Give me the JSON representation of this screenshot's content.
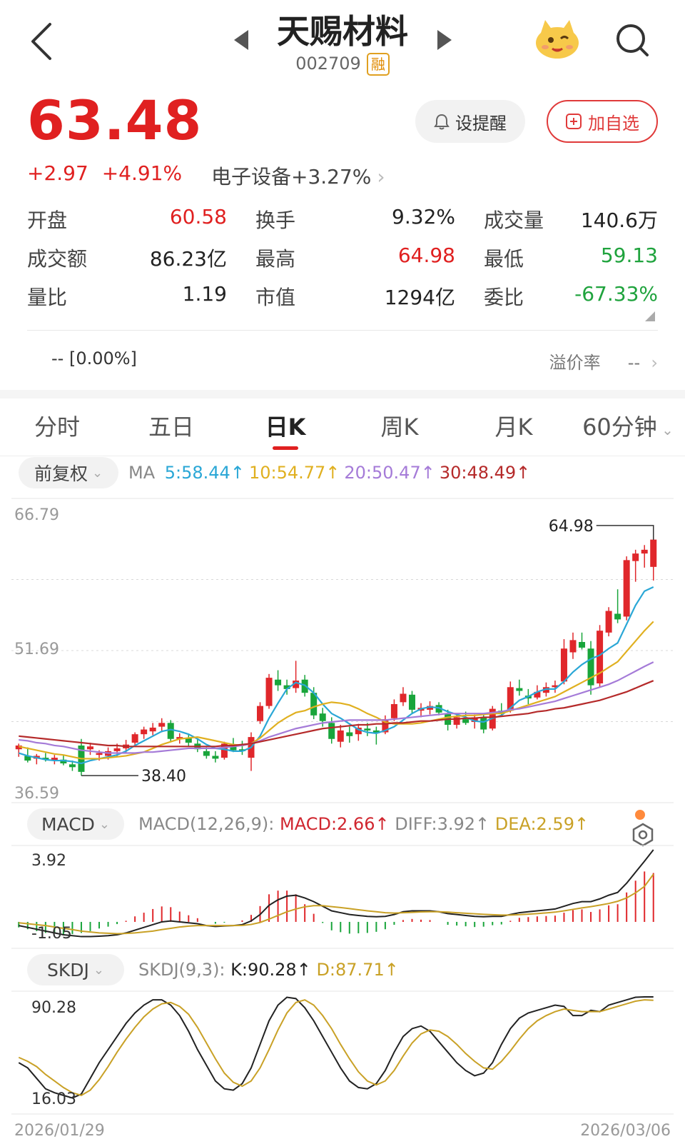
{
  "header": {
    "name": "天赐材料",
    "code": "002709",
    "badge": "融"
  },
  "quote": {
    "price": "63.48",
    "change": "+2.97",
    "change_pct": "+4.91%",
    "sector": "电子设备+3.27%",
    "alert_label": "设提醒",
    "add_label": "加自选"
  },
  "stats": [
    [
      {
        "label": "开盘",
        "value": "60.58",
        "color": "red"
      },
      {
        "label": "换手",
        "value": "9.32%",
        "color": "black"
      },
      {
        "label": "成交量",
        "value": "140.6万",
        "color": "black"
      }
    ],
    [
      {
        "label": "成交额",
        "value": "86.23亿",
        "color": "black"
      },
      {
        "label": "最高",
        "value": "64.98",
        "color": "red"
      },
      {
        "label": "最低",
        "value": "59.13",
        "color": "green"
      }
    ],
    [
      {
        "label": "量比",
        "value": "1.19",
        "color": "black"
      },
      {
        "label": "市值",
        "value": "1294亿",
        "color": "black"
      },
      {
        "label": "委比",
        "value": "-67.33%",
        "color": "green"
      }
    ]
  ],
  "premium": {
    "left": "-- [0.00%]",
    "label": "溢价率",
    "value": "--"
  },
  "tabs": [
    "分时",
    "五日",
    "日K",
    "周K",
    "月K",
    "60分钟"
  ],
  "active_tab": 2,
  "ma_panel": {
    "adjust_label": "前复权",
    "prefix": "MA",
    "items": [
      {
        "text": "5:58.44↑",
        "color": "#2aa7d6"
      },
      {
        "text": "10:54.77↑",
        "color": "#e0b020"
      },
      {
        "text": "20:50.47↑",
        "color": "#a57bd8"
      },
      {
        "text": "30:48.49↑",
        "color": "#b52a2a"
      }
    ]
  },
  "macd_panel": {
    "label": "MACD",
    "params": "MACD(12,26,9):",
    "macd": "MACD:2.66↑",
    "diff": "DIFF:3.92↑",
    "dea": "DEA:2.59↑"
  },
  "skdj_panel": {
    "label": "SKDJ",
    "params": "SKDJ(9,3):",
    "k": "K:90.28↑",
    "d": "D:87.71↑"
  },
  "chart_data": {
    "type": "candlestick",
    "price_axis": {
      "top": "66.79",
      "mid": "51.69",
      "bottom": "36.59",
      "max": 66.79,
      "min": 36.59
    },
    "annotations": {
      "high": "64.98",
      "low": "38.40"
    },
    "candles": [
      [
        41.2,
        41.8,
        40.4,
        41.6
      ],
      [
        40.5,
        41.4,
        39.8,
        40.0
      ],
      [
        40.2,
        40.7,
        39.6,
        40.5
      ],
      [
        40.3,
        40.8,
        39.9,
        40.1
      ],
      [
        40.0,
        40.6,
        39.6,
        40.3
      ],
      [
        40.1,
        40.6,
        39.5,
        39.7
      ],
      [
        39.6,
        40.0,
        38.9,
        39.3
      ],
      [
        41.6,
        42.3,
        38.4,
        38.8
      ],
      [
        41.2,
        41.9,
        40.6,
        41.5
      ],
      [
        40.6,
        41.1,
        40.0,
        40.8
      ],
      [
        40.5,
        41.4,
        40.1,
        41.0
      ],
      [
        41.0,
        41.8,
        40.4,
        41.3
      ],
      [
        41.3,
        42.2,
        40.8,
        41.7
      ],
      [
        41.9,
        43.0,
        41.5,
        42.8
      ],
      [
        42.8,
        43.6,
        42.3,
        43.3
      ],
      [
        43.1,
        44.0,
        42.7,
        43.5
      ],
      [
        43.6,
        44.5,
        43.0,
        44.0
      ],
      [
        44.0,
        44.3,
        42.0,
        42.3
      ],
      [
        42.3,
        42.9,
        41.8,
        42.5
      ],
      [
        42.4,
        42.8,
        41.5,
        41.9
      ],
      [
        41.8,
        42.3,
        40.9,
        41.2
      ],
      [
        41.0,
        41.4,
        40.2,
        40.5
      ],
      [
        40.5,
        41.0,
        39.8,
        40.2
      ],
      [
        40.3,
        42.0,
        40.1,
        41.8
      ],
      [
        41.6,
        42.4,
        40.9,
        41.1
      ],
      [
        41.2,
        42.1,
        40.6,
        41.0
      ],
      [
        40.3,
        43.0,
        38.9,
        42.5
      ],
      [
        44.2,
        46.2,
        43.9,
        45.8
      ],
      [
        45.8,
        49.2,
        45.5,
        48.8
      ],
      [
        48.6,
        49.6,
        47.4,
        48.0
      ],
      [
        48.0,
        48.6,
        47.0,
        47.6
      ],
      [
        47.7,
        50.6,
        47.2,
        48.5
      ],
      [
        48.6,
        49.1,
        46.8,
        47.2
      ],
      [
        47.2,
        47.8,
        44.4,
        44.8
      ],
      [
        45.0,
        45.6,
        43.6,
        44.2
      ],
      [
        44.0,
        44.6,
        41.8,
        42.3
      ],
      [
        42.0,
        43.8,
        41.4,
        43.2
      ],
      [
        43.0,
        43.6,
        41.9,
        42.6
      ],
      [
        42.8,
        43.9,
        42.1,
        43.5
      ],
      [
        43.4,
        44.0,
        42.6,
        43.2
      ],
      [
        43.2,
        43.6,
        41.7,
        42.9
      ],
      [
        43.0,
        44.8,
        42.8,
        44.4
      ],
      [
        44.5,
        46.5,
        44.2,
        46.0
      ],
      [
        46.2,
        47.8,
        45.8,
        47.1
      ],
      [
        47.0,
        47.4,
        45.0,
        45.4
      ],
      [
        45.3,
        46.1,
        44.6,
        45.6
      ],
      [
        45.4,
        46.3,
        44.9,
        45.8
      ],
      [
        45.9,
        46.2,
        44.8,
        45.1
      ],
      [
        45.0,
        45.4,
        43.2,
        43.8
      ],
      [
        43.8,
        44.9,
        43.4,
        44.6
      ],
      [
        44.4,
        45.2,
        43.8,
        44.0
      ],
      [
        44.1,
        44.9,
        43.4,
        44.6
      ],
      [
        44.6,
        45.0,
        42.9,
        43.3
      ],
      [
        43.4,
        45.8,
        43.2,
        45.5
      ],
      [
        45.3,
        46.1,
        44.7,
        45.0
      ],
      [
        45.3,
        48.4,
        45.1,
        47.8
      ],
      [
        47.7,
        48.6,
        46.9,
        47.4
      ],
      [
        46.9,
        47.6,
        46.0,
        46.6
      ],
      [
        46.7,
        48.0,
        46.5,
        47.3
      ],
      [
        47.2,
        48.3,
        46.8,
        47.8
      ],
      [
        47.8,
        48.5,
        47.2,
        48.0
      ],
      [
        48.4,
        52.9,
        48.1,
        51.9
      ],
      [
        51.5,
        53.6,
        50.8,
        52.8
      ],
      [
        52.6,
        53.6,
        51.8,
        52.0
      ],
      [
        51.9,
        52.7,
        47.0,
        48.0
      ],
      [
        48.2,
        54.4,
        47.8,
        53.8
      ],
      [
        53.6,
        56.3,
        53.2,
        55.9
      ],
      [
        55.6,
        58.2,
        54.6,
        55.0
      ],
      [
        55.3,
        61.7,
        54.9,
        61.3
      ],
      [
        61.2,
        62.4,
        59.0,
        62.0
      ],
      [
        62.0,
        62.9,
        60.5,
        62.4
      ],
      [
        60.58,
        64.98,
        59.13,
        63.48
      ]
    ],
    "ma5": [
      40.8,
      40.5,
      40.3,
      40.1,
      40.0,
      40.0,
      39.9,
      39.7,
      40.0,
      40.2,
      40.4,
      40.6,
      41.0,
      41.6,
      42.1,
      42.6,
      43.1,
      43.3,
      43.1,
      42.8,
      42.3,
      41.7,
      41.3,
      41.2,
      41.0,
      41.0,
      41.4,
      42.6,
      44.5,
      46.1,
      47.6,
      48.3,
      48.0,
      47.2,
      46.0,
      45.0,
      44.5,
      43.9,
      43.3,
      43.0,
      42.9,
      43.2,
      43.6,
      44.3,
      45.0,
      45.5,
      45.7,
      45.6,
      45.2,
      44.9,
      44.6,
      44.2,
      44.1,
      44.5,
      44.8,
      45.6,
      46.4,
      46.8,
      47.3,
      47.6,
      47.6,
      48.4,
      49.4,
      50.2,
      50.8,
      51.2,
      51.9,
      52.5,
      54.5,
      56.5,
      58.0,
      58.44
    ],
    "ma10": [
      41.5,
      41.3,
      41.1,
      40.9,
      40.7,
      40.6,
      40.4,
      40.2,
      40.2,
      40.2,
      40.3,
      40.4,
      40.5,
      40.7,
      40.9,
      41.3,
      41.7,
      42.0,
      42.3,
      42.4,
      42.5,
      42.3,
      42.1,
      41.9,
      41.7,
      41.6,
      41.8,
      42.4,
      43.2,
      44.0,
      44.6,
      45.1,
      45.3,
      45.7,
      46.0,
      46.2,
      46.1,
      45.9,
      45.5,
      45.0,
      44.6,
      44.1,
      43.9,
      43.9,
      43.9,
      44.0,
      44.2,
      44.4,
      44.6,
      44.7,
      44.8,
      44.8,
      44.9,
      45.0,
      45.0,
      45.3,
      45.6,
      45.9,
      46.2,
      46.5,
      46.8,
      47.3,
      47.8,
      48.3,
      48.8,
      49.3,
      49.9,
      50.5,
      51.6,
      52.7,
      53.8,
      54.77
    ],
    "ma20": [
      42.2,
      42.1,
      41.9,
      41.8,
      41.6,
      41.5,
      41.3,
      41.1,
      41.0,
      40.9,
      40.8,
      40.8,
      40.8,
      40.8,
      40.9,
      40.9,
      41.0,
      41.1,
      41.2,
      41.3,
      41.3,
      41.3,
      41.3,
      41.4,
      41.5,
      41.6,
      41.8,
      42.1,
      42.5,
      42.8,
      43.1,
      43.4,
      43.6,
      43.8,
      44.0,
      44.1,
      44.2,
      44.3,
      44.3,
      44.3,
      44.3,
      44.3,
      44.4,
      44.5,
      44.6,
      44.7,
      44.8,
      44.9,
      45.0,
      45.0,
      45.0,
      45.0,
      45.0,
      45.1,
      45.2,
      45.4,
      45.5,
      45.7,
      45.9,
      46.1,
      46.3,
      46.6,
      46.9,
      47.2,
      47.5,
      47.8,
      48.1,
      48.5,
      49.0,
      49.5,
      50.0,
      50.47
    ],
    "ma30": [
      42.6,
      42.5,
      42.4,
      42.3,
      42.2,
      42.1,
      42.0,
      41.9,
      41.8,
      41.7,
      41.6,
      41.6,
      41.5,
      41.5,
      41.5,
      41.5,
      41.5,
      41.5,
      41.5,
      41.5,
      41.5,
      41.5,
      41.5,
      41.6,
      41.6,
      41.7,
      41.8,
      42.0,
      42.2,
      42.4,
      42.6,
      42.8,
      43.0,
      43.2,
      43.4,
      43.5,
      43.6,
      43.7,
      43.8,
      43.8,
      43.9,
      43.9,
      44.0,
      44.0,
      44.1,
      44.2,
      44.2,
      44.3,
      44.4,
      44.4,
      44.5,
      44.5,
      44.6,
      44.6,
      44.7,
      44.8,
      44.9,
      45.0,
      45.2,
      45.3,
      45.5,
      45.6,
      45.8,
      46.0,
      46.2,
      46.4,
      46.7,
      47.0,
      47.3,
      47.7,
      48.1,
      48.49
    ],
    "macd_axis": {
      "top": "3.92",
      "bottom": "-1.05",
      "max": 3.92,
      "min": -1.05
    },
    "diff": [
      -0.2,
      -0.3,
      -0.4,
      -0.5,
      -0.6,
      -0.7,
      -0.75,
      -0.8,
      -0.8,
      -0.78,
      -0.75,
      -0.7,
      -0.6,
      -0.45,
      -0.3,
      -0.15,
      0.0,
      0.05,
      0.0,
      -0.05,
      -0.1,
      -0.2,
      -0.25,
      -0.22,
      -0.2,
      -0.15,
      0.05,
      0.4,
      0.9,
      1.2,
      1.4,
      1.45,
      1.3,
      1.1,
      0.85,
      0.6,
      0.5,
      0.4,
      0.35,
      0.3,
      0.28,
      0.3,
      0.4,
      0.55,
      0.6,
      0.6,
      0.6,
      0.55,
      0.45,
      0.4,
      0.35,
      0.3,
      0.28,
      0.3,
      0.3,
      0.4,
      0.5,
      0.55,
      0.6,
      0.65,
      0.7,
      0.85,
      1.0,
      1.1,
      1.1,
      1.25,
      1.45,
      1.6,
      2.1,
      2.7,
      3.3,
      3.92
    ],
    "dea": [
      -0.05,
      -0.1,
      -0.15,
      -0.2,
      -0.28,
      -0.35,
      -0.42,
      -0.5,
      -0.55,
      -0.6,
      -0.62,
      -0.64,
      -0.63,
      -0.6,
      -0.55,
      -0.5,
      -0.42,
      -0.35,
      -0.28,
      -0.23,
      -0.2,
      -0.2,
      -0.2,
      -0.2,
      -0.2,
      -0.19,
      -0.14,
      -0.03,
      0.15,
      0.35,
      0.55,
      0.7,
      0.82,
      0.88,
      0.88,
      0.83,
      0.78,
      0.72,
      0.66,
      0.6,
      0.55,
      0.5,
      0.48,
      0.5,
      0.52,
      0.54,
      0.55,
      0.55,
      0.53,
      0.5,
      0.47,
      0.44,
      0.41,
      0.39,
      0.37,
      0.37,
      0.39,
      0.42,
      0.45,
      0.49,
      0.53,
      0.6,
      0.68,
      0.76,
      0.83,
      0.91,
      1.0,
      1.12,
      1.3,
      1.58,
      1.93,
      2.59
    ],
    "macd_hist": [
      -0.3,
      -0.4,
      -0.5,
      -0.6,
      -0.64,
      -0.7,
      -0.66,
      -0.6,
      -0.5,
      -0.36,
      -0.26,
      -0.12,
      0.06,
      0.3,
      0.5,
      0.7,
      0.84,
      0.8,
      0.56,
      0.36,
      0.2,
      0.0,
      -0.1,
      -0.04,
      0.0,
      0.08,
      0.38,
      0.86,
      1.5,
      1.7,
      1.7,
      1.5,
      0.96,
      0.44,
      -0.06,
      -0.46,
      -0.56,
      -0.64,
      -0.62,
      -0.6,
      -0.54,
      -0.4,
      -0.16,
      0.1,
      0.16,
      0.12,
      0.1,
      0.0,
      -0.16,
      -0.2,
      -0.24,
      -0.28,
      -0.26,
      -0.18,
      -0.14,
      0.06,
      0.22,
      0.26,
      0.3,
      0.32,
      0.34,
      0.5,
      0.64,
      0.68,
      0.54,
      0.68,
      0.9,
      0.96,
      1.6,
      2.24,
      2.74,
      2.66
    ],
    "skdj_axis": {
      "top": "90.28",
      "bottom": "16.03",
      "max": 90.28,
      "min": 16.03
    },
    "k": [
      40,
      36,
      28,
      20,
      17,
      15,
      13,
      16,
      28,
      40,
      50,
      60,
      70,
      78,
      84,
      88,
      88,
      84,
      76,
      64,
      50,
      38,
      26,
      20,
      19,
      24,
      36,
      54,
      72,
      84,
      90,
      89,
      82,
      72,
      60,
      48,
      36,
      26,
      21,
      20,
      24,
      34,
      48,
      60,
      66,
      68,
      64,
      56,
      48,
      40,
      34,
      30,
      32,
      40,
      54,
      66,
      74,
      78,
      80,
      82,
      84,
      83,
      76,
      76,
      80,
      79,
      84,
      86,
      88,
      90,
      90.28,
      90.28
    ],
    "d": [
      44,
      41,
      37,
      31,
      26,
      21,
      17,
      15,
      19,
      27,
      37,
      48,
      58,
      67,
      75,
      81,
      85,
      86,
      83,
      77,
      67,
      55,
      43,
      32,
      25,
      22,
      26,
      36,
      50,
      65,
      78,
      86,
      88,
      84,
      76,
      66,
      54,
      43,
      33,
      26,
      23,
      26,
      34,
      45,
      55,
      62,
      65,
      64,
      60,
      54,
      47,
      41,
      36,
      35,
      41,
      49,
      58,
      66,
      72,
      76,
      79,
      81,
      80,
      79,
      79,
      79,
      81,
      83,
      85,
      87,
      88,
      87.71
    ]
  },
  "axis_dates": {
    "start": "2026/01/29",
    "end": "2026/03/06"
  }
}
